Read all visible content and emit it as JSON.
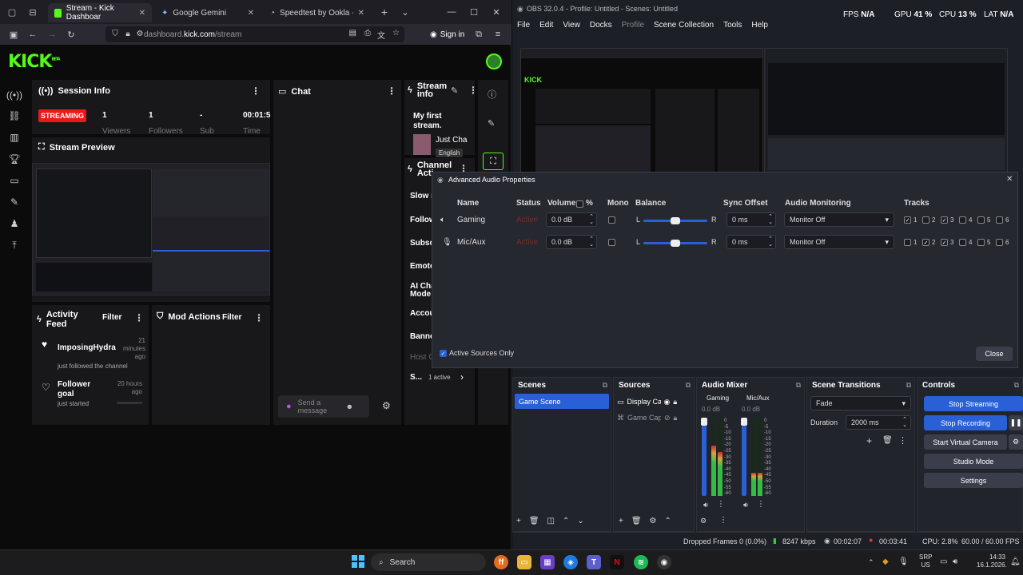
{
  "browser": {
    "tabs": [
      {
        "label": "Stream - Kick Dashboar",
        "active": true
      },
      {
        "label": "Google Gemini",
        "active": false
      },
      {
        "label": "Speedtest by Ookla - The G",
        "active": false
      }
    ],
    "url_domain": "dashboard.",
    "url_bold": "kick.com",
    "url_path": "/stream",
    "sign_in": "Sign in"
  },
  "kick": {
    "logo": "KICK",
    "logo_beta": "BETA",
    "session": {
      "title": "Session Info",
      "status": "STREAMING",
      "stats": [
        {
          "value": "1",
          "label": "Viewers"
        },
        {
          "value": "1",
          "label": "Followers"
        },
        {
          "value": "-",
          "label": "Sub"
        },
        {
          "value": "00:01:5",
          "label": "Time"
        }
      ]
    },
    "preview_title": "Stream Preview",
    "chat": {
      "title": "Chat",
      "placeholder": "Send a message"
    },
    "stream_info": {
      "title": "Stream info",
      "stream_title": "My first stream.",
      "category": "Just Cha",
      "language": "English",
      "channel_actions": "Channel Acti",
      "actions": [
        "Slow m",
        "Follow",
        "Subsc",
        "Emote",
        "AI Cha Mode",
        "Accou",
        "Banne",
        "Host C"
      ],
      "s_label": "S...",
      "active_count": "1 active"
    },
    "activity": {
      "title": "Activity Feed",
      "filter": "Filter",
      "items": [
        {
          "name": "ImposingHydra",
          "time": "21 minutes ago",
          "desc": "just followed the channel"
        },
        {
          "name": "Follower goal",
          "time": "20 hours ago",
          "desc": "just started"
        }
      ]
    },
    "mod": {
      "title": "Mod Actions",
      "filter": "Filter"
    }
  },
  "obs": {
    "title": "OBS 32.0.4 - Profile: Untitled - Scenes: Untitled",
    "stats": {
      "fps_label": "FPS",
      "fps": "N/A",
      "gpu_label": "GPU",
      "gpu": "41 %",
      "cpu_label": "CPU",
      "cpu": "13 %",
      "lat_label": "LAT",
      "lat": "N/A"
    },
    "menu": [
      "File",
      "Edit",
      "View",
      "Docks",
      "Profile",
      "Scene Collection",
      "Tools",
      "Help"
    ],
    "dialog": {
      "title": "Advanced Audio Properties",
      "columns": {
        "name": "Name",
        "status": "Status",
        "volume": "Volume",
        "percent": "%",
        "mono": "Mono",
        "balance": "Balance",
        "sync": "Sync Offset",
        "monitoring": "Audio Monitoring",
        "tracks": "Tracks"
      },
      "rows": [
        {
          "name": "Gaming",
          "status": "Active",
          "volume": "0.0 dB",
          "bal_l": "L",
          "bal_r": "R",
          "sync": "0 ms",
          "monitoring": "Monitor Off",
          "tracks": [
            true,
            false,
            true,
            false,
            false,
            false
          ]
        },
        {
          "name": "Mic/Aux",
          "status": "Active",
          "volume": "0.0 dB",
          "bal_l": "L",
          "bal_r": "R",
          "sync": "0 ms",
          "monitoring": "Monitor Off",
          "tracks": [
            false,
            true,
            true,
            false,
            false,
            false
          ]
        }
      ],
      "track_numbers": [
        "1",
        "2",
        "3",
        "4",
        "5",
        "6"
      ],
      "active_only": "Active Sources Only",
      "close": "Close"
    },
    "docks": {
      "scenes": {
        "title": "Scenes",
        "items": [
          "Game Scene"
        ]
      },
      "sources": {
        "title": "Sources",
        "items": [
          "Display Ca",
          "Game Cap"
        ]
      },
      "mixer": {
        "title": "Audio Mixer",
        "channels": [
          {
            "name": "Gaming",
            "db": "0.0 dB"
          },
          {
            "name": "Mic/Aux",
            "db": "0.0 dB"
          }
        ],
        "scale": [
          "0",
          "-5",
          "-10",
          "-15",
          "-20",
          "-25",
          "-30",
          "-35",
          "-40",
          "-45",
          "-50",
          "-55",
          "-60"
        ]
      },
      "transitions": {
        "title": "Scene Transitions",
        "type": "Fade",
        "duration_label": "Duration",
        "duration": "2000 ms"
      },
      "controls": {
        "title": "Controls",
        "buttons": [
          "Stop Streaming",
          "Stop Recording",
          "Start Virtual Camera",
          "Studio Mode",
          "Settings"
        ]
      }
    },
    "status": {
      "dropped": "Dropped Frames 0 (0.0%)",
      "kbps": "8247 kbps",
      "stream_time": "00:02:07",
      "rec_time": "00:03:41",
      "cpu": "CPU: 2.8%",
      "fps": "60.00 / 60.00 FPS"
    }
  },
  "taskbar": {
    "search": "Search",
    "lang": "SRP",
    "lang2": "US",
    "time": "14:33",
    "date": "16.1.2026."
  }
}
